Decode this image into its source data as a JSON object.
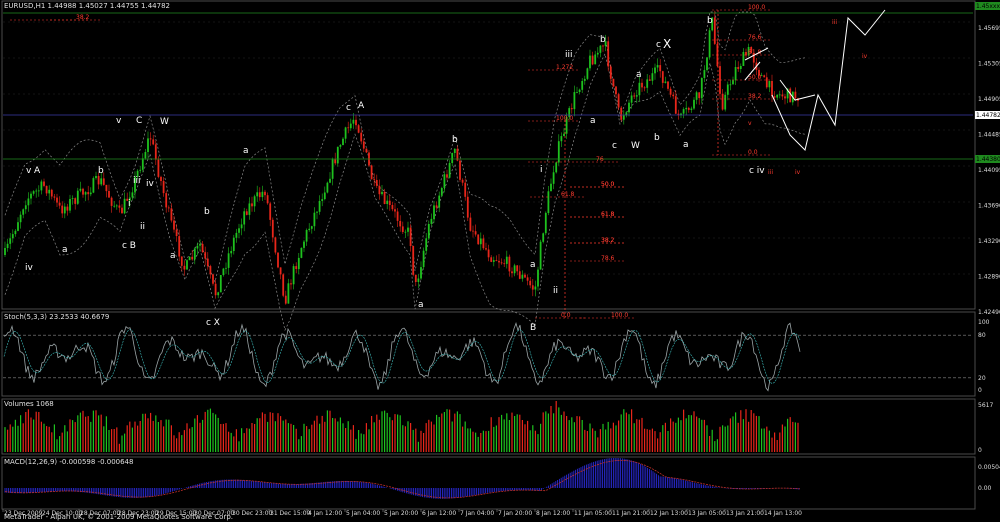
{
  "main": {
    "header": "EURUSD,H1  1.44988 1.45027 1.44755 1.44782",
    "y_ticks": [
      "1.45695",
      "1.45305",
      "1.44905",
      "1.44485",
      "1.44095",
      "1.43690",
      "1.43290",
      "1.42890",
      "1.42490"
    ],
    "y_min": 1.4249,
    "y_max": 1.4585,
    "price_tag": "1.44782",
    "green_tag": "1.44380",
    "top_tag": "1.45xxx"
  },
  "stoch": {
    "label": "Stoch(5,3,3) 23.2533 40.6679",
    "ticks": [
      "100",
      "80",
      "20",
      "0"
    ],
    "levels": [
      80,
      20
    ]
  },
  "volume": {
    "label": "Volumes 1068",
    "ticks": [
      "5617",
      "0"
    ]
  },
  "macd": {
    "label": "MACD(12,26,9) -0.000598 -0.000648",
    "ticks": [
      "0.005044",
      "0.00"
    ]
  },
  "copyright": "MetaTrader - Alpari UK, © 2001-2009 MetaQuotes Software Corp.",
  "x_labels": [
    "23 Dec 2009",
    "24 Dec 10:00",
    "28 Dec 07:00",
    "28 Dec 23:00",
    "29 Dec 15:00",
    "30 Dec 07:00",
    "30 Dec 23:00",
    "31 Dec 15:00",
    "4 Jan 12:00",
    "5 Jan 04:00",
    "5 Jan 20:00",
    "6 Jan 12:00",
    "7 Jan 04:00",
    "7 Jan 20:00",
    "8 Jan 12:00",
    "11 Jan 05:00",
    "11 Jan 21:00",
    "12 Jan 13:00",
    "13 Jan 05:00",
    "13 Jan 21:00",
    "14 Jan 13:00"
  ],
  "fib_left": [
    "38.2",
    "1.272",
    "100.0",
    "76",
    "61.8",
    "50.0",
    "61.8",
    "38.2",
    "78.6",
    "0.0",
    "100.0",
    "61.8",
    "50.0",
    "38.2"
  ],
  "fib_right": [
    "100.0",
    "76.6",
    "61.8",
    "50.0",
    "38.2",
    "0.0"
  ],
  "wave_labels": [
    {
      "t": "v",
      "big": false
    },
    {
      "t": "A",
      "big": false
    },
    {
      "t": "iv",
      "big": false
    },
    {
      "t": "a",
      "big": false
    },
    {
      "t": "b",
      "big": false
    },
    {
      "t": "i",
      "big": false
    },
    {
      "t": "ii",
      "big": false
    },
    {
      "t": "c B",
      "big": false
    },
    {
      "t": "iii",
      "big": false
    },
    {
      "t": "iv",
      "big": false
    },
    {
      "t": "v",
      "big": false
    },
    {
      "t": "C",
      "big": false
    },
    {
      "t": "W",
      "big": false
    },
    {
      "t": "a",
      "big": false
    },
    {
      "t": "b",
      "big": false
    },
    {
      "t": "a",
      "big": false
    },
    {
      "t": "c X",
      "big": false
    },
    {
      "t": "c",
      "big": false
    },
    {
      "t": "A",
      "big": false
    },
    {
      "t": "a",
      "big": false
    },
    {
      "t": "b",
      "big": false
    },
    {
      "t": "a",
      "big": false
    },
    {
      "t": "B",
      "big": false
    },
    {
      "t": "i",
      "big": false
    },
    {
      "t": "ii",
      "big": false
    },
    {
      "t": "iii",
      "big": false
    },
    {
      "t": "b",
      "big": false
    },
    {
      "t": "a",
      "big": false
    },
    {
      "t": "c",
      "big": false
    },
    {
      "t": "W",
      "big": false
    },
    {
      "t": "b",
      "big": false
    },
    {
      "t": "a",
      "big": false
    },
    {
      "t": "a",
      "big": false
    },
    {
      "t": "c",
      "big": false
    },
    {
      "t": "X",
      "big": true
    },
    {
      "t": "b",
      "big": false
    },
    {
      "t": "c iv",
      "big": false
    }
  ],
  "red_labels": [
    "iii",
    "iv",
    "iii",
    "iv",
    "v"
  ],
  "colors": {
    "bull": "#1ec21e",
    "bear": "#e8261a",
    "grid": "#2b2b2b",
    "frame": "#4a4a4a",
    "price_line": "#3a3aa8",
    "green_line": "#1f8a1f",
    "fib": "#ff3b2f",
    "stoch": "#9aa4a6",
    "stoch_sig": "#3fbfbf",
    "macd": "#2a2ad6",
    "signal": "#c0302a"
  }
}
